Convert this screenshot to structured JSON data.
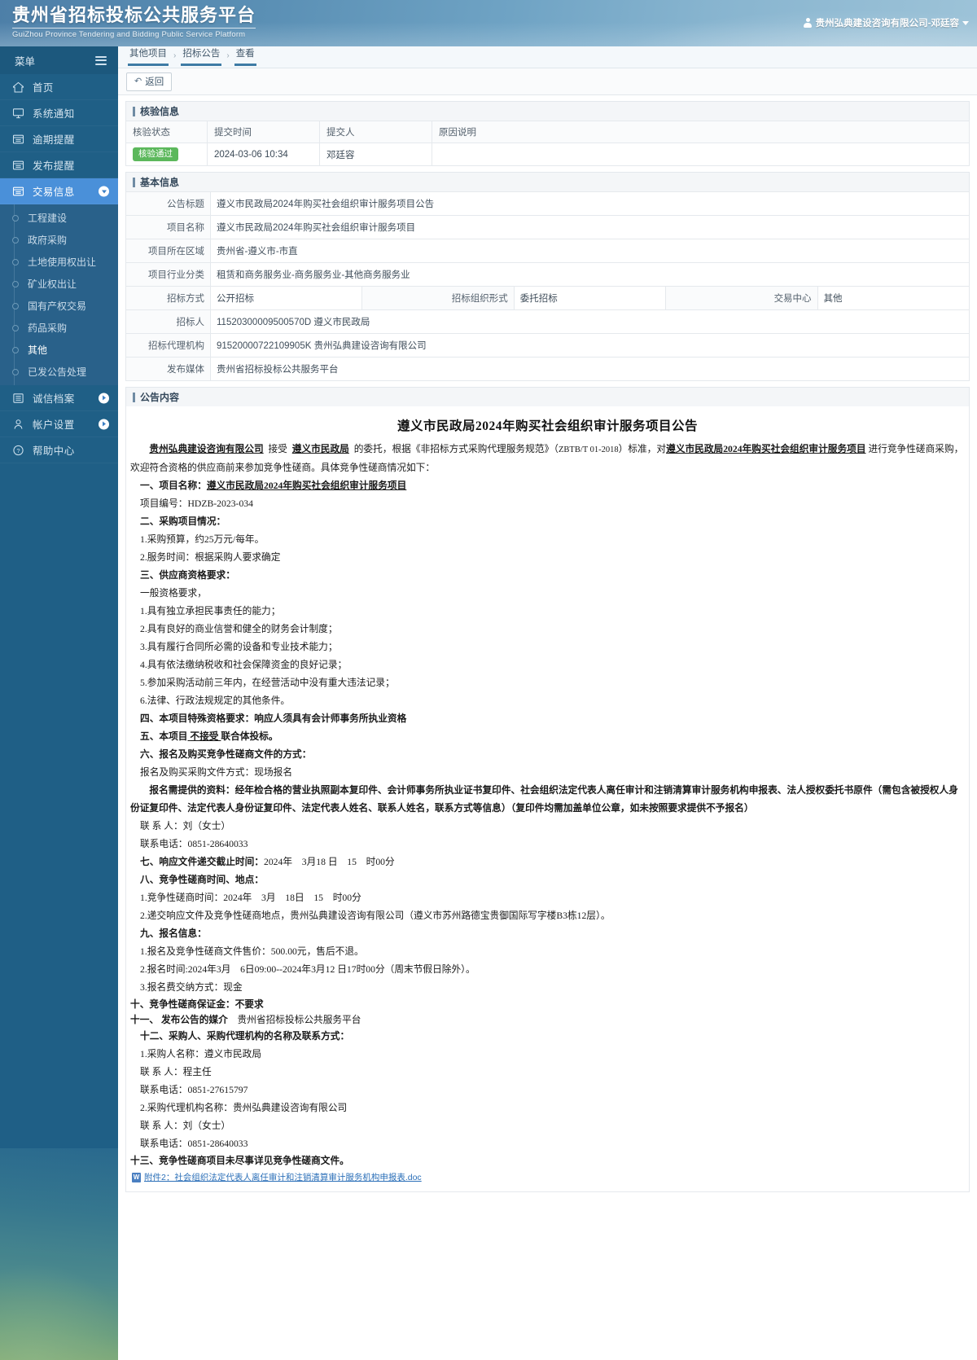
{
  "header": {
    "title_cn": "贵州省招标投标公共服务平台",
    "title_en": "GuiZhou Province Tendering and Bidding Public Service Platform",
    "user": "贵州弘典建设咨询有限公司-邓廷容"
  },
  "sidebar": {
    "menu_label": "菜单",
    "items": [
      {
        "label": "首页",
        "icon": "home-icon"
      },
      {
        "label": "系统通知",
        "icon": "monitor-icon"
      },
      {
        "label": "逾期提醒",
        "icon": "list-icon"
      },
      {
        "label": "发布提醒",
        "icon": "list-icon"
      },
      {
        "label": "交易信息",
        "icon": "list-icon"
      }
    ],
    "sub_items": [
      "工程建设",
      "政府采购",
      "土地使用权出让",
      "矿业权出让",
      "国有产权交易",
      "药品采购",
      "其他",
      "已发公告处理"
    ],
    "bottom_items": [
      {
        "label": "诚信档案",
        "icon": "archive-icon"
      },
      {
        "label": "帐户设置",
        "icon": "person-icon"
      },
      {
        "label": "帮助中心",
        "icon": "question-icon"
      }
    ]
  },
  "breadcrumb": {
    "items": [
      "其他项目",
      "招标公告",
      "查看"
    ],
    "sep": "›"
  },
  "toolbar": {
    "back_label": "返回",
    "back_icon": "undo-icon"
  },
  "verify": {
    "section_title": "核验信息",
    "columns": [
      "核验状态",
      "提交时间",
      "提交人",
      "原因说明"
    ],
    "rows": [
      {
        "status": "核验通过",
        "time": "2024-03-06 10:34",
        "person": "邓廷容",
        "reason": ""
      }
    ]
  },
  "basic": {
    "section_title": "基本信息",
    "rows": [
      {
        "label": "公告标题",
        "value": "遵义市民政局2024年购买社会组织审计服务项目公告"
      },
      {
        "label": "项目名称",
        "value": "遵义市民政局2024年购买社会组织审计服务项目"
      },
      {
        "label": "项目所在区域",
        "value": "贵州省-遵义市-市直"
      },
      {
        "label": "项目行业分类",
        "value": "租赁和商务服务业-商务服务业-其他商务服务业"
      }
    ],
    "split_row": {
      "label1": "招标方式",
      "value1": "公开招标",
      "label2": "招标组织形式",
      "value2": "委托招标",
      "label3": "交易中心",
      "value3": "其他"
    },
    "rows2": [
      {
        "label": "招标人",
        "value": "11520300009500570D 遵义市民政局"
      },
      {
        "label": "招标代理机构",
        "value": "91520000722109905K 贵州弘典建设咨询有限公司"
      },
      {
        "label": "发布媒体",
        "value": "贵州省招标投标公共服务平台"
      }
    ]
  },
  "announcement": {
    "section_title": "公告内容",
    "title": "遵义市民政局2024年购买社会组织审计服务项目公告",
    "intro_seg1": "贵州弘典建设咨询有限公司",
    "intro_seg2": "接受",
    "intro_seg3": "遵义市民政局",
    "intro_seg4": "的委托，根据《非招标方式采购代理服务规范》（",
    "intro_seg5": "ZBTB/T 01-2018",
    "intro_seg6": "）标准，对",
    "intro_seg7": "遵义市民政局2024年购买社会组织审计服务项目",
    "intro_seg8": "进行竞争性磋商采购，欢迎符合资格的供应商前来参加竞争性磋商。具体竞争性磋商情况如下：",
    "s1_head": "一、项目名称：",
    "s1_name": "遵义市民政局2024年购买社会组织审计服务项目",
    "s1_code": "项目编号：HDZB-2023-034",
    "s2_head": "二、采购项目情况：",
    "s2_1": "1.采购预算，约25万元/每年。",
    "s2_2": "2.服务时间：根据采购人要求确定",
    "s3_head": "三、供应商资格要求：",
    "s3_intro": "一般资格要求，",
    "s3_items": [
      "1.具有独立承担民事责任的能力；",
      "2.具有良好的商业信誉和健全的财务会计制度；",
      "3.具有履行合同所必需的设备和专业技术能力；",
      "4.具有依法缴纳税收和社会保障资金的良好记录；",
      "5.参加采购活动前三年内，在经营活动中没有重大违法记录；",
      "6.法律、行政法规规定的其他条件。"
    ],
    "s4": "四、本项目特殊资格要求：响应人须具有会计师事务所执业资格",
    "s5_a": "五、本项目",
    "s5_b": "不接受",
    "s5_c": "联合体投标。",
    "s6_head": "六、报名及购买竞争性磋商文件的方式：",
    "s6_1": "报名及购买采购文件方式：现场报名",
    "s6_2": "报名需提供的资料：经年检合格的营业执照副本复印件、会计师事务所执业证书复印件、社会组织法定代表人离任审计和注销清算审计服务机构申报表、法人授权委托书原件（需包含被授权人身份证复印件、法定代表人身份证复印件、法定代表人姓名、联系人姓名，联系方式等信息）（复印件均需加盖单位公章，如未按照要求提供不予报名）",
    "s6_contact": "联 系 人：刘（女士）",
    "s6_phone": "联系电话：0851-28640033",
    "s7": "七、响应文件递交截止时间：",
    "s7_val": "2024年　3月18 日　15　时00分",
    "s8_head": "八、竞争性磋商时间、地点：",
    "s8_1": "1.竞争性磋商时间：2024年　3月　18日　15　时00分",
    "s8_2": "2.递交响应文件及竞争性磋商地点，贵州弘典建设咨询有限公司（遵义市苏州路德宝贵御国际写字楼B3栋12层）。",
    "s9_head": "九、报名信息：",
    "s9_1": "1.报名及竞争性磋商文件售价：500.00元，售后不退。",
    "s9_2": "2.报名时间:2024年3月　6日09:00--2024年3月12 日17时00分（周末节假日除外）。",
    "s9_3": "3.报名费交纳方式：现金",
    "s10": "十、竞争性磋商保证金：不要求",
    "s11_a": "十一、 发布公告的媒介",
    "s11_b": "贵州省招标投标公共服务平台",
    "s12_head": "十二、采购人、采购代理机构的名称及联系方式：",
    "s12_1": "1.采购人名称：遵义市民政局",
    "s12_c1": "联 系 人：程主任",
    "s12_p1": "联系电话：0851-27615797",
    "s12_2": "2.采购代理机构名称：贵州弘典建设咨询有限公司",
    "s12_c2": "联 系 人：刘（女士）",
    "s12_p2": "联系电话：0851-28640033",
    "s13": "十三、竞争性磋商项目未尽事详见竞争性磋商文件。",
    "attachment": "附件2：社会组织法定代表人离任审计和注销清算审计服务机构申报表.doc"
  },
  "colors": {
    "accent": "#4a90d9",
    "sidebar": "#1f5f86",
    "success": "#5cb85c",
    "link": "#2b6fb8"
  }
}
